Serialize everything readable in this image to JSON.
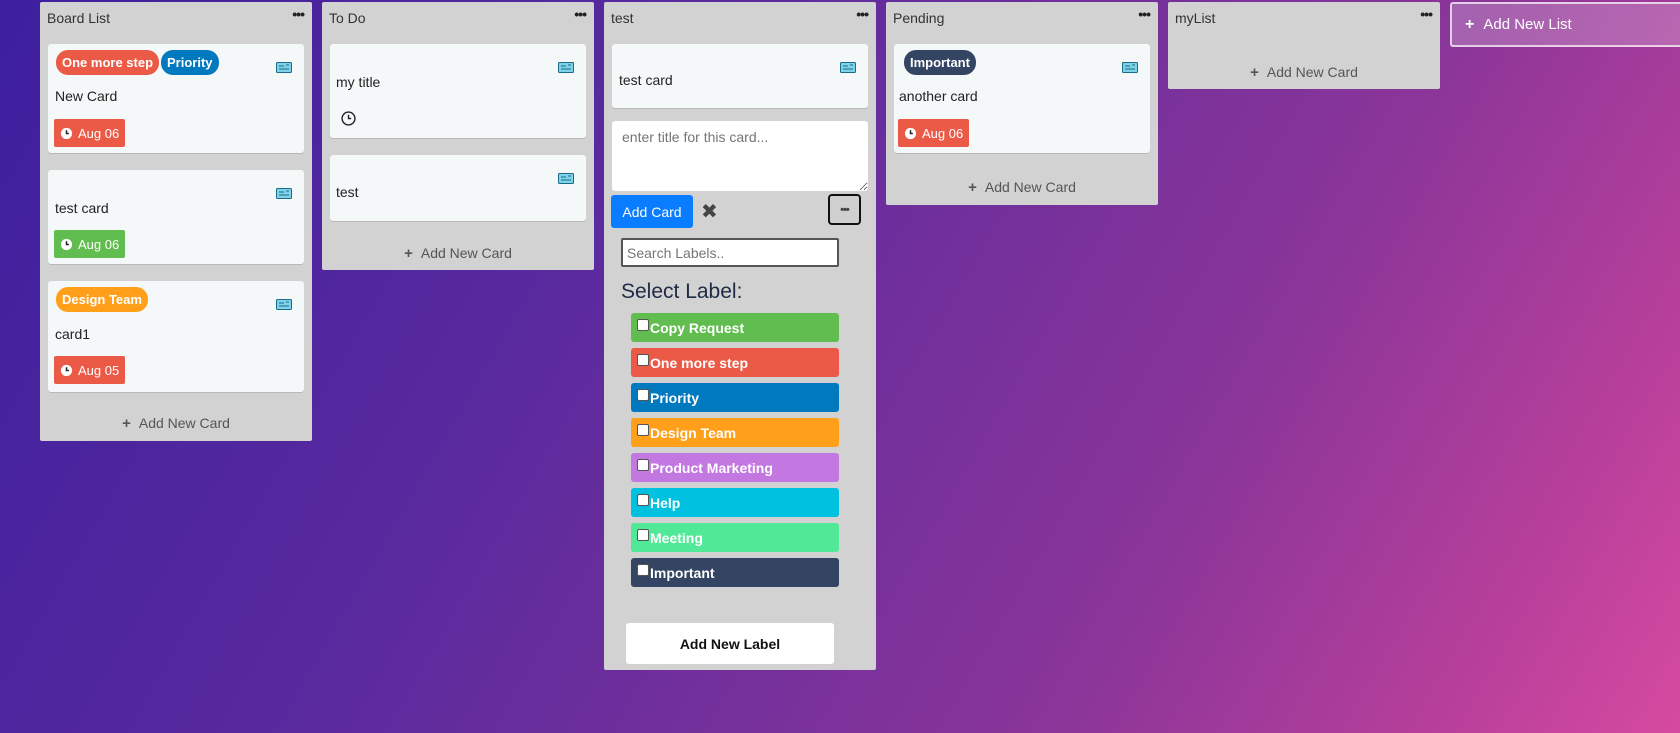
{
  "lists": {
    "board": {
      "title": "Board List",
      "cards": [
        {
          "labels": [
            "One more step",
            "Priority"
          ],
          "title": "New Card",
          "due": "Aug 06",
          "due_color": "#eb5a46"
        },
        {
          "labels": [],
          "title": "test card",
          "due": "Aug 06",
          "due_color": "#61bd4f"
        },
        {
          "labels": [
            "Design Team"
          ],
          "title": "card1",
          "due": "Aug 05",
          "due_color": "#eb5a46"
        }
      ],
      "add_card": "Add New Card"
    },
    "todo": {
      "title": "To Do",
      "cards": [
        {
          "title": "my title"
        },
        {
          "title": "test"
        }
      ],
      "add_card": "Add New Card"
    },
    "test": {
      "title": "test",
      "cards": [
        {
          "title": "test card"
        }
      ],
      "composer": {
        "placeholder": "enter title for this card...",
        "add_button": "Add Card",
        "search_placeholder": "Search Labels..",
        "select_heading": "Select Label:",
        "add_label_button": "Add New Label"
      }
    },
    "pending": {
      "title": "Pending",
      "cards": [
        {
          "labels": [
            "Important"
          ],
          "title": "another card",
          "due": "Aug 06",
          "due_color": "#eb5a46"
        }
      ],
      "add_card": "Add New Card"
    },
    "mylist": {
      "title": "myList",
      "add_card": "Add New Card"
    }
  },
  "add_list": "Add New List",
  "label_options": [
    {
      "name": "Copy Request",
      "color": "#61bd4f"
    },
    {
      "name": "One more step",
      "color": "#eb5a46"
    },
    {
      "name": "Priority",
      "color": "#0079bf"
    },
    {
      "name": "Design Team",
      "color": "#ff9f1a"
    },
    {
      "name": "Product Marketing",
      "color": "#c377e0"
    },
    {
      "name": "Help",
      "color": "#00c2e0"
    },
    {
      "name": "Meeting",
      "color": "#51e898"
    },
    {
      "name": "Important",
      "color": "#344563"
    }
  ],
  "label_colors": {
    "One more step": "#eb5a46",
    "Priority": "#0079bf",
    "Design Team": "#ff9f1a",
    "Important": "#344563"
  }
}
